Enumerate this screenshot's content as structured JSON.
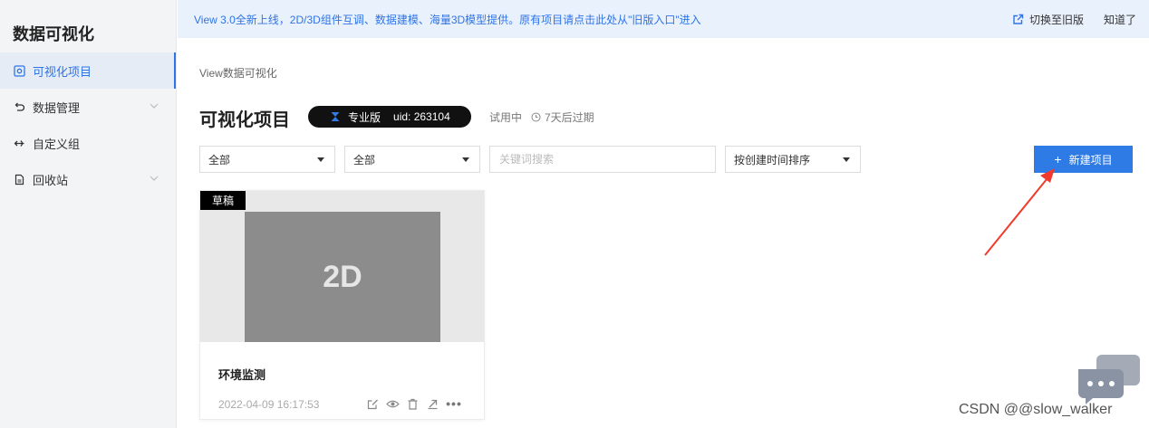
{
  "sidebar": {
    "title": "数据可视化",
    "items": [
      {
        "label": "可视化项目",
        "active": true,
        "icon": "visualization-icon"
      },
      {
        "label": "数据管理",
        "active": false,
        "icon": "undo-icon"
      },
      {
        "label": "自定义组",
        "active": false,
        "icon": "move-icon"
      },
      {
        "label": "回收站",
        "active": false,
        "icon": "document-icon"
      }
    ]
  },
  "notice": {
    "text": "View 3.0全新上线，2D/3D组件互调、数据建模、海量3D模型提供。原有项目请点击此处从\"旧版入口\"进入",
    "switch_label": "切换至旧版",
    "dismiss_label": "知道了"
  },
  "breadcrumb": "View数据可视化",
  "page_title": "可视化项目",
  "badge": {
    "edition": "专业版",
    "uid": "uid: 263104"
  },
  "trial_status": "试用中",
  "expire_text": "7天后过期",
  "filters": {
    "filter1": "全部",
    "filter2": "全部",
    "search_placeholder": "关键词搜索",
    "sort": "按创建时间排序"
  },
  "new_button_label": "新建项目",
  "card": {
    "tag": "草稿",
    "thumb_label": "2D",
    "name": "环境监测",
    "date": "2022-04-09 16:17:53"
  },
  "watermark": "CSDN @@slow_walker",
  "colors": {
    "accent": "#2f7be6",
    "notice_bg": "#e9f1fc",
    "arrow": "#f03a2e"
  }
}
